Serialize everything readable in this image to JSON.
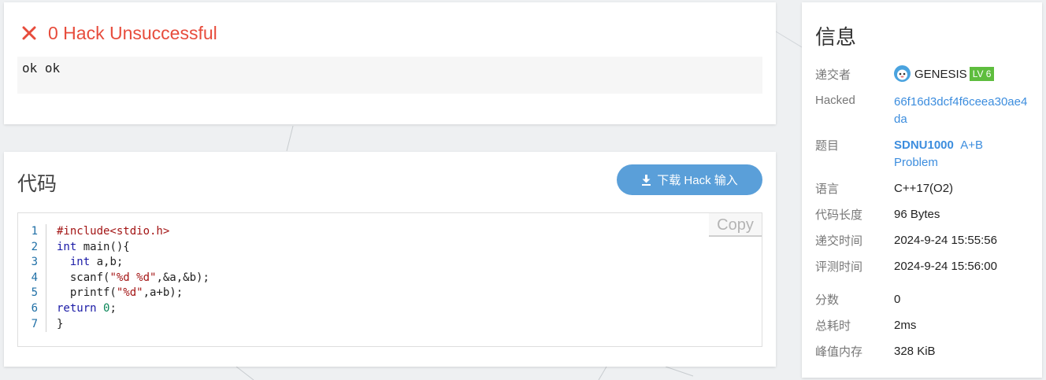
{
  "result": {
    "status": "0 Hack Unsuccessful",
    "output": "ok ok"
  },
  "code": {
    "title": "代码",
    "download_label": "下载 Hack 输入",
    "copy_label": "Copy",
    "lines": [
      {
        "n": "1",
        "text": "#include<stdio.h>"
      },
      {
        "n": "2",
        "text": "int main(){"
      },
      {
        "n": "3",
        "text": "  int a,b;"
      },
      {
        "n": "4",
        "text": "  scanf(\"%d %d\",&a,&b);"
      },
      {
        "n": "5",
        "text": "  printf(\"%d\",a+b);"
      },
      {
        "n": "6",
        "text": "return 0;"
      },
      {
        "n": "7",
        "text": "}"
      }
    ]
  },
  "info": {
    "title": "信息",
    "submitter_label": "递交者",
    "submitter_name": "GENESIS",
    "submitter_level": "LV 6",
    "hacked_label": "Hacked",
    "hacked_value": "66f16d3dcf4f6ceea30ae4da",
    "problem_label": "题目",
    "problem_id": "SDNU1000",
    "problem_name": "A+B Problem",
    "language_label": "语言",
    "language_value": "C++17(O2)",
    "code_length_label": "代码长度",
    "code_length_value": "96 Bytes",
    "submit_time_label": "递交时间",
    "submit_time_value": "2024-9-24 15:55:56",
    "judge_time_label": "评测时间",
    "judge_time_value": "2024-9-24 15:56:00",
    "score_label": "分数",
    "score_value": "0",
    "time_label": "总耗时",
    "time_value": "2ms",
    "memory_label": "峰值内存",
    "memory_value": "328 KiB"
  },
  "colors": {
    "error": "#e74c3c",
    "accent": "#5a9fd9",
    "link": "#3c8dde",
    "level_badge": "#5ebd3e"
  },
  "icons": {
    "status": "close-icon",
    "download": "download-icon",
    "avatar": "avatar-icon"
  }
}
